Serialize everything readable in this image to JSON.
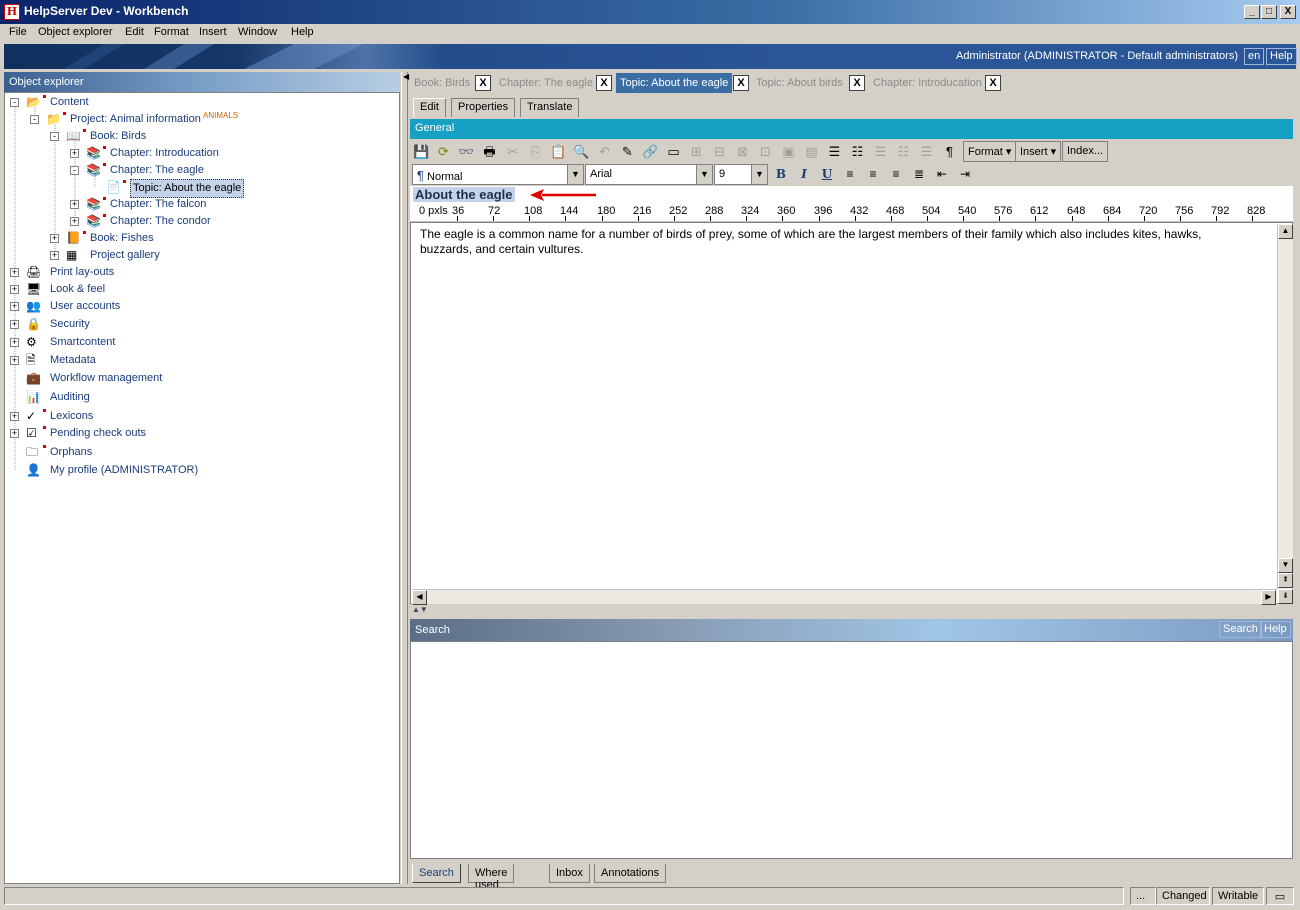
{
  "window": {
    "title": "HelpServer Dev - Workbench",
    "app_icon": "H",
    "buttons": {
      "minimize": "_",
      "maximize": "□",
      "close": "X"
    }
  },
  "menu": [
    "File",
    "Object explorer",
    "Edit",
    "Format",
    "Insert",
    "Window",
    "Help"
  ],
  "banner": {
    "user": "Administrator (ADMINISTRATOR - Default administrators)",
    "lang_button": "en",
    "help_button": "Help"
  },
  "object_explorer": {
    "title": "Object explorer",
    "tree": [
      {
        "label": "Content",
        "icon": "folder-open-icon"
      },
      {
        "label": "Project: Animal information",
        "tag": "ANIMALS",
        "icon": "project-icon"
      },
      {
        "label": "Book: Birds",
        "icon": "book-open-icon"
      },
      {
        "label": "Chapter: Introducation",
        "icon": "chapter-icon"
      },
      {
        "label": "Chapter: The eagle",
        "icon": "chapter-icon"
      },
      {
        "label": "Topic: About the eagle",
        "icon": "topic-icon"
      },
      {
        "label": "Chapter: The falcon",
        "icon": "chapter-icon"
      },
      {
        "label": "Chapter: The condor",
        "icon": "chapter-icon"
      },
      {
        "label": "Book: Fishes",
        "icon": "book-icon"
      },
      {
        "label": "Project gallery",
        "icon": "gallery-icon"
      },
      {
        "label": "Print lay-outs",
        "icon": "printer-icon"
      },
      {
        "label": "Look & feel",
        "icon": "monitor-icon"
      },
      {
        "label": "User accounts",
        "icon": "users-icon"
      },
      {
        "label": "Security",
        "icon": "lock-icon"
      },
      {
        "label": "Smartcontent",
        "icon": "smartcontent-icon"
      },
      {
        "label": "Metadata",
        "icon": "metadata-icon"
      },
      {
        "label": "Workflow management",
        "icon": "briefcase-icon"
      },
      {
        "label": "Auditing",
        "icon": "bar-chart-icon"
      },
      {
        "label": "Lexicons",
        "icon": "spellcheck-icon"
      },
      {
        "label": "Pending check outs",
        "icon": "checkout-icon"
      },
      {
        "label": "Orphans",
        "icon": "orphans-icon"
      },
      {
        "label": "My profile (ADMINISTRATOR)",
        "icon": "user-icon"
      }
    ]
  },
  "doc_tabs": [
    {
      "label": "Book: Birds",
      "active": false
    },
    {
      "label": "Chapter: The eagle",
      "active": false
    },
    {
      "label": "Topic: About the eagle",
      "active": true
    },
    {
      "label": "Topic: About birds",
      "active": false
    },
    {
      "label": "Chapter: Introducation",
      "active": false
    }
  ],
  "close_glyph": "X",
  "sub_tabs": [
    "Edit",
    "Properties",
    "Translate"
  ],
  "general_label": "General",
  "toolbar": {
    "format_menu": "Format",
    "insert_menu": "Insert",
    "index_button": "Index...",
    "pilcrow": "¶"
  },
  "format_bar": {
    "style": "Normal",
    "font": "Arial",
    "size": "9",
    "bold": "B",
    "italic": "I",
    "underline": "U"
  },
  "document": {
    "title": "About the eagle",
    "body": "The eagle is a common name for a number of birds of prey, some of which are the largest members of their family which also includes kites, hawks, buzzards, and certain vultures."
  },
  "ruler": {
    "unit_label": "0 pxls",
    "marks": [
      "36",
      "72",
      "108",
      "144",
      "180",
      "216",
      "252",
      "288",
      "324",
      "360",
      "396",
      "432",
      "468",
      "504",
      "540",
      "576",
      "612",
      "648",
      "684",
      "720",
      "756",
      "792",
      "828"
    ]
  },
  "search_panel": {
    "title": "Search",
    "search_button": "Search",
    "help_button": "Help"
  },
  "bottom_tabs": [
    "Search",
    "Where used",
    "Inbox",
    "Annotations"
  ],
  "status": {
    "ellipsis": "...",
    "changed": "Changed",
    "writable": "Writable"
  },
  "colors": {
    "accent": "#16a0c4",
    "title_bar": "#0a246a",
    "link": "#1a3d78",
    "annotation_arrow": "#e00000"
  }
}
